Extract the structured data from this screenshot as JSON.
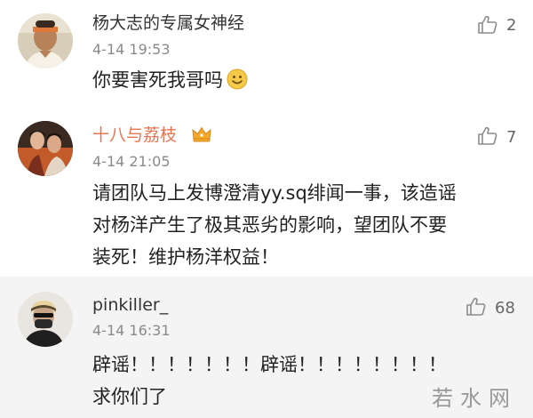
{
  "comments": [
    {
      "username": "杨大志的专属女神经",
      "timestamp": "4-14 19:53",
      "text_lines": [
        "你要害死我哥吗"
      ],
      "likes": "2",
      "emoji": "smile-emoji",
      "vip": false
    },
    {
      "username": "十八与荔枝",
      "timestamp": "4-14 21:05",
      "text_lines": [
        "请团队马上发博澄清yy.sq绯闻一事，该造谣",
        "对杨洋产生了极其恶劣的影响，望团队不要",
        "装死！维护杨洋权益！"
      ],
      "likes": "7",
      "vip": true,
      "badge_icon": "crown-icon"
    },
    {
      "username": "pinkiller_",
      "timestamp": "4-14 16:31",
      "text_lines": [
        "辟谣！！！！！！！辟谣！！！！！！！！",
        "求你们了"
      ],
      "likes": "68",
      "vip": false
    }
  ],
  "watermark": "若水网",
  "icons": {
    "like": "thumbs-up-icon"
  },
  "colors": {
    "vip_name": "#eb7350",
    "name": "#333333",
    "timestamp": "#8a8a8a",
    "text": "#222222",
    "like": "#8c8c8c",
    "crown": "#f4a92b"
  }
}
